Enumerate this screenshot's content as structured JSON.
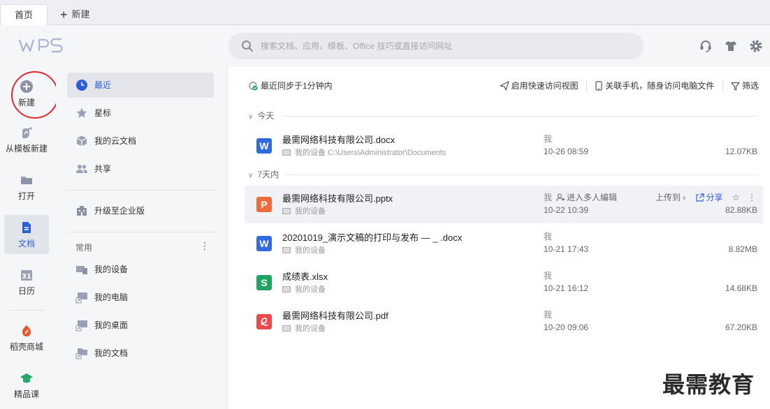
{
  "tabs": {
    "home": "首页",
    "new_tab": "新建"
  },
  "header": {
    "search_placeholder": "搜索文档、应用、模板、Office 技巧或直接访问网址",
    "icons": [
      "headset-icon",
      "tshirt-icon",
      "gear-icon"
    ]
  },
  "rail": {
    "items": [
      {
        "label": "新建",
        "icon": "plus-circle-icon"
      },
      {
        "label": "从模板新建",
        "icon": "template-icon"
      },
      {
        "label": "打开",
        "icon": "folder-icon"
      },
      {
        "label": "文档",
        "icon": "document-icon",
        "active": true
      },
      {
        "label": "日历",
        "icon": "calendar-icon"
      },
      {
        "label": "稻壳商城",
        "icon": "docer-icon"
      },
      {
        "label": "精品课",
        "icon": "graduation-icon"
      }
    ]
  },
  "panel": {
    "items": [
      {
        "label": "最近",
        "icon": "clock-icon",
        "active": true
      },
      {
        "label": "星标",
        "icon": "star-icon"
      },
      {
        "label": "我的云文档",
        "icon": "cloud-doc-icon"
      },
      {
        "label": "共享",
        "icon": "share-users-icon"
      }
    ],
    "upgrade": "升级至企业版",
    "section": "常用",
    "section_more": "⋮",
    "places": [
      {
        "label": "我的设备"
      },
      {
        "label": "我的电脑"
      },
      {
        "label": "我的桌面"
      },
      {
        "label": "我的文档"
      }
    ]
  },
  "main": {
    "sync": "最近同步于1分钟内",
    "tools": {
      "quick_view": "启用快速访问视图",
      "phone": "关联手机，随身访问电脑文件",
      "filter": "筛选"
    },
    "groups": {
      "today": "今天",
      "week": "7天内"
    },
    "files": [
      {
        "name": "最需网络科技有限公司.docx",
        "location": "我的设备 C:\\Users\\Administrator\\Documents",
        "owner": "我",
        "time": "10-26 08:59",
        "size": "12.07KB",
        "type": "W",
        "color": "#2f6ae1"
      },
      {
        "name": "最需网络科技有限公司.pptx",
        "location": "我的设备",
        "owner": "我",
        "collab": "进入多人编辑",
        "time": "10-22 10:39",
        "size": "82.88KB",
        "type": "P",
        "color": "#ee6b3b",
        "upload": "上传到 ›",
        "share": "分享",
        "star": "☆",
        "more": "⋮"
      },
      {
        "name": "20201019_演示文稿的打印与发布 — _ .docx",
        "location": "我的设备",
        "owner": "我",
        "time": "10-21 17:43",
        "size": "8.82MB",
        "type": "W",
        "color": "#2f6ae1"
      },
      {
        "name": "成绩表.xlsx",
        "location": "我的设备",
        "owner": "我",
        "time": "10-21 16:12",
        "size": "14.68KB",
        "type": "S",
        "color": "#1fa463"
      },
      {
        "name": "最需网络科技有限公司.pdf",
        "location": "我的设备",
        "owner": "我",
        "time": "10-20 09:06",
        "size": "67.20KB",
        "type": "pdf",
        "color": "#ea4a4a"
      }
    ]
  },
  "watermark": "最需教育"
}
